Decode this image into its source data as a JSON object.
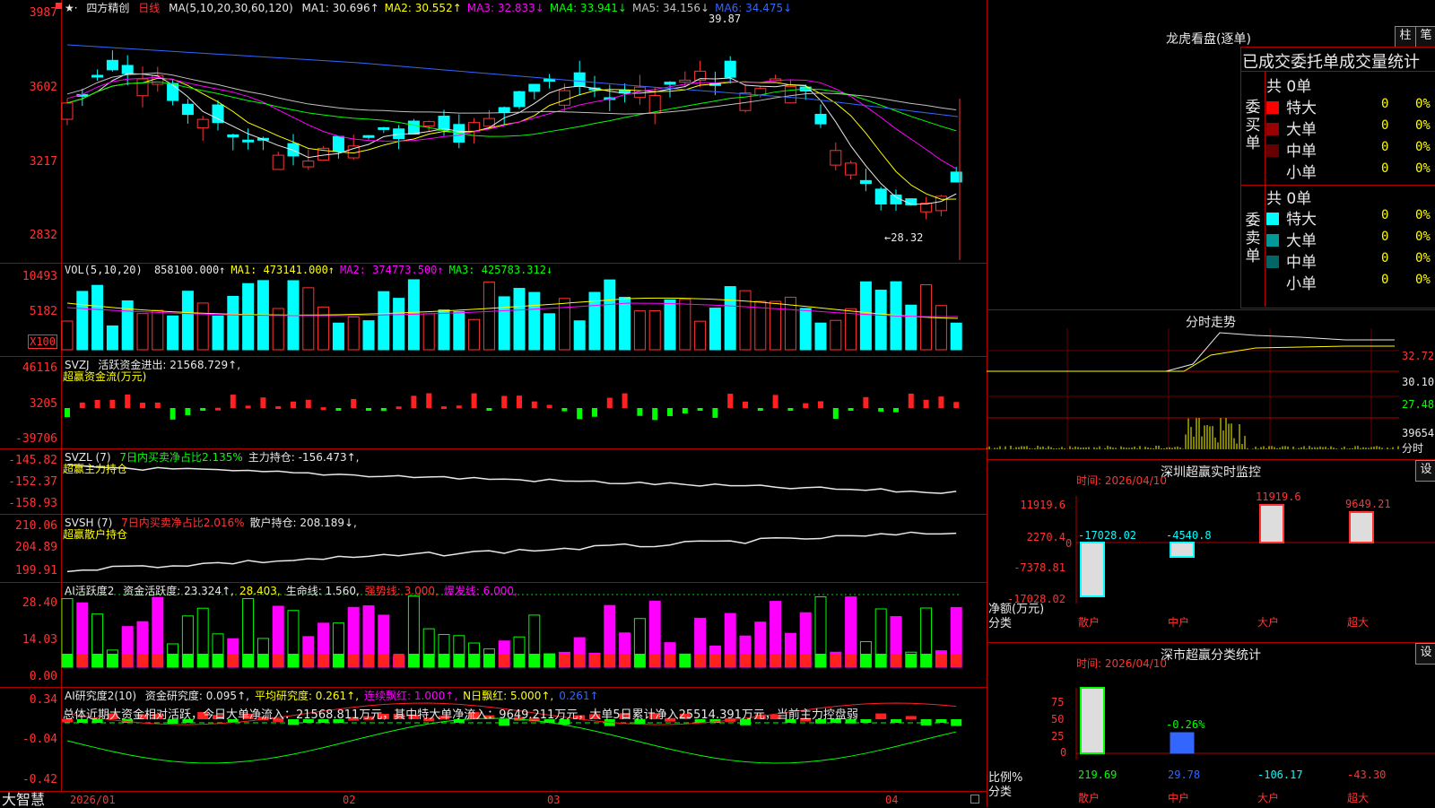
{
  "main_chart": {
    "title_prefix": "★·",
    "stock_name": "四方精创",
    "period": "日线",
    "ma_label": "MA(5,10,20,30,60,120)",
    "ma": [
      {
        "text": "MA1: 30.696↑",
        "color": "#e8e8e8"
      },
      {
        "text": "MA2: 30.552↑",
        "color": "#ffff00"
      },
      {
        "text": "MA3: 32.833↓",
        "color": "#ff00ff"
      },
      {
        "text": "MA4: 33.941↓",
        "color": "#00ff00"
      },
      {
        "text": "MA5: 34.156↓",
        "color": "#c0c0c0"
      },
      {
        "text": "MA6: 34.475↓",
        "color": "#3366ff"
      }
    ],
    "y_labels": [
      "3987",
      "3602",
      "3217",
      "2832"
    ],
    "high_label": "39.87",
    "low_label": "←28.32"
  },
  "vol_panel": {
    "label": "VOL(5,10,20)",
    "items": [
      {
        "text": "858100.000↑",
        "color": "#e8e8e8"
      },
      {
        "text": "MA1: 473141.000↑",
        "color": "#ffff00"
      },
      {
        "text": "MA2: 374773.500↑",
        "color": "#ff00ff"
      },
      {
        "text": "MA3: 425783.312↓",
        "color": "#00ff00"
      }
    ],
    "y_labels": [
      "10493",
      "5182"
    ],
    "unit_badge": "X100"
  },
  "svzj_panel": {
    "label": "SVZJ",
    "items": [
      {
        "text": "活跃资金进出: 21568.729↑,",
        "color": "#e8e8e8"
      }
    ],
    "subtitle": "超赢资金流(万元)",
    "y_labels": [
      "46116",
      "3205",
      "-39706"
    ]
  },
  "svzl_panel": {
    "label": "SVZL (7)",
    "items": [
      {
        "text": "7日内买卖净占比2.135%",
        "color": "#00ff00"
      },
      {
        "text": "主力持仓: -156.473↑,",
        "color": "#e8e8e8"
      }
    ],
    "subtitle": "超赢主力持仓",
    "y_labels": [
      "-145.82",
      "-152.37",
      "-158.93"
    ]
  },
  "svsh_panel": {
    "label": "SVSH (7)",
    "items": [
      {
        "text": "7日内买卖净占比2.016%",
        "color": "#ff3333"
      },
      {
        "text": "散户持仓: 208.189↓,",
        "color": "#e8e8e8"
      }
    ],
    "subtitle": "超赢散户持仓",
    "y_labels": [
      "210.06",
      "204.89",
      "199.91"
    ]
  },
  "ai_active_panel": {
    "label": "AI活跃度2",
    "items": [
      {
        "text": "资金活跃度: 23.324↑,",
        "color": "#e8e8e8"
      },
      {
        "text": "28.403,",
        "color": "#ffff00"
      },
      {
        "text": "生命线: 1.560,",
        "color": "#e8e8e8"
      },
      {
        "text": "强势线: 3.000,",
        "color": "#ff3333"
      },
      {
        "text": "爆发线: 6.000,",
        "color": "#ff00ff"
      }
    ],
    "y_labels": [
      "28.40",
      "14.03",
      "0.00"
    ]
  },
  "ai_research_panel": {
    "label": "AI研究度2(10)",
    "items": [
      {
        "text": "资金研究度: 0.095↑,",
        "color": "#e8e8e8"
      },
      {
        "text": "平均研究度: 0.261↑,",
        "color": "#ffff00"
      },
      {
        "text": "连续飘红: 1.000↑,",
        "color": "#ff00ff"
      },
      {
        "text": "N日飘红: 5.000↑,",
        "color": "#ffff00"
      },
      {
        "text": "0.261↑",
        "color": "#3366ff"
      }
    ],
    "summary": "总体近期大资金相对活跃，今日大单净流入：21568.811万元，其中特大单净流入：9649.211万元，大单5日累计净入25514.391万元，当前主力控盘弱",
    "y_labels": [
      "0.34",
      "-0.04",
      "-0.42"
    ]
  },
  "bottom_axis": {
    "brand": "大智慧",
    "dates": [
      "2026/01",
      "02",
      "03",
      "04"
    ]
  },
  "dragon_tiger": {
    "title": "龙虎看盘(逐单)",
    "btn_column": "柱",
    "btn_stroke": "笔",
    "table_title": "已成交委托单成交量统计",
    "buy": {
      "side_label": "委买单",
      "count": "共 0单",
      "rows": [
        {
          "label": "特大",
          "count": "0",
          "pct": "0%",
          "color": "#ff0000"
        },
        {
          "label": "大单",
          "count": "0",
          "pct": "0%",
          "color": "#990000"
        },
        {
          "label": "中单",
          "count": "0",
          "pct": "0%",
          "color": "#660000"
        },
        {
          "label": "小单",
          "count": "0",
          "pct": "0%",
          "color": "#000000"
        }
      ]
    },
    "sell": {
      "side_label": "委卖单",
      "count": "共 0单",
      "rows": [
        {
          "label": "特大",
          "count": "0",
          "pct": "0%",
          "color": "#00ffff"
        },
        {
          "label": "大单",
          "count": "0",
          "pct": "0%",
          "color": "#009999"
        },
        {
          "label": "中单",
          "count": "0",
          "pct": "0%",
          "color": "#006666"
        },
        {
          "label": "小单",
          "count": "0",
          "pct": "0%",
          "color": "#000000"
        }
      ]
    }
  },
  "intraday": {
    "title": "分时走势",
    "y_labels": [
      "32.72",
      "30.10",
      "27.48",
      "39654"
    ],
    "vol_unit": "分时"
  },
  "sz_monitor": {
    "title": "深圳超赢实时监控",
    "btn": "设",
    "time": "时间: 2026/04/10",
    "y_labels": [
      "11919.6",
      "2270.4",
      "-7378.81",
      "-17028.02"
    ],
    "bars": [
      {
        "label": "散户",
        "value": "-17028.02"
      },
      {
        "label": "中户",
        "value": "-4540.8"
      },
      {
        "label": "大户",
        "value": "11919.6"
      },
      {
        "label": "超大",
        "value": "9649.21"
      }
    ],
    "zero": "0",
    "axis_title_1": "净额(万元)",
    "axis_title_2": "分类"
  },
  "sz_class": {
    "title": "深市超赢分类统计",
    "btn": "设",
    "time": "时间: 2026/04/10",
    "y_labels": [
      "75",
      "50",
      "25",
      "0"
    ],
    "bars": [
      {
        "label": "散户",
        "value": "219.69",
        "color": "#00ff00"
      },
      {
        "label": "中户",
        "value": "29.78",
        "color": "#3366ff"
      },
      {
        "label": "大户",
        "value": "-106.17",
        "color": "#00ffff"
      },
      {
        "label": "超大",
        "value": "-43.30",
        "color": "#ff3333"
      }
    ],
    "mid_label": "-0.26%",
    "axis_title_1": "比例%",
    "axis_title_2": "分类"
  }
}
